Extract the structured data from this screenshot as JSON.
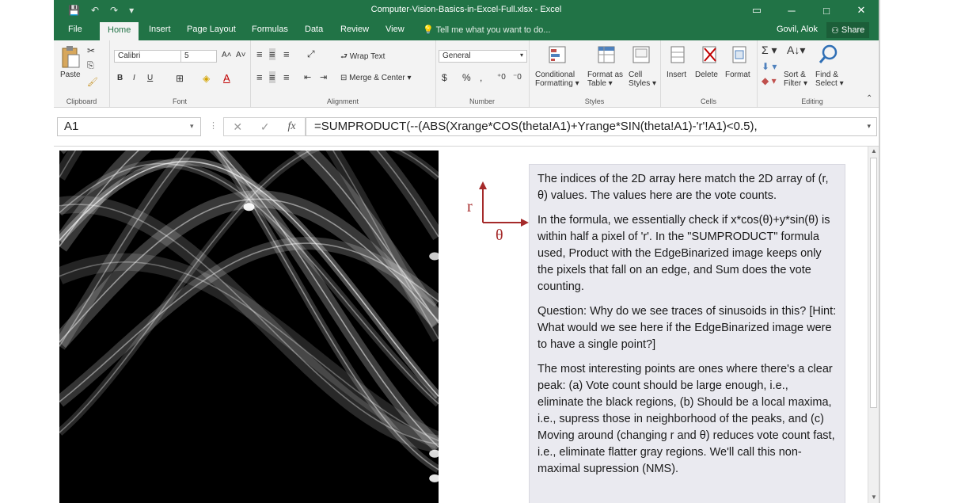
{
  "window": {
    "title": "Computer-Vision-Basics-in-Excel-Full.xlsx - Excel",
    "controls": [
      "▭",
      "─",
      "□",
      "✕"
    ]
  },
  "qat": {
    "save": "💾",
    "undo": "↶",
    "redo": "↷",
    "more": "▾"
  },
  "tabs": [
    "File",
    "Home",
    "Insert",
    "Page Layout",
    "Formulas",
    "Data",
    "Review",
    "View"
  ],
  "active_tab": "Home",
  "tellme": "Tell me what you want to do...",
  "user": "Govil, Alok",
  "share_label": "Share",
  "ribbon": {
    "clipboard": {
      "label": "Clipboard",
      "paste": "Paste"
    },
    "font": {
      "label": "Font",
      "name": "Calibri",
      "size": "5",
      "bold": "B",
      "italic": "I",
      "underline": "U"
    },
    "alignment": {
      "label": "Alignment",
      "wrap": "Wrap Text",
      "merge": "Merge & Center"
    },
    "number": {
      "label": "Number",
      "format": "General",
      "currency": "$",
      "percent": "%",
      "comma": ","
    },
    "styles": {
      "label": "Styles",
      "conditional_1": "Conditional",
      "conditional_2": "Formatting",
      "table_1": "Format as",
      "table_2": "Table",
      "cell_1": "Cell",
      "cell_2": "Styles"
    },
    "cells": {
      "label": "Cells",
      "insert": "Insert",
      "delete": "Delete",
      "format": "Format"
    },
    "editing": {
      "label": "Editing",
      "sort_1": "Sort &",
      "sort_2": "Filter",
      "find_1": "Find &",
      "find_2": "Select"
    }
  },
  "formula_bar": {
    "name_box": "A1",
    "fx": "fx",
    "formula": "=SUMPRODUCT(--(ABS(Xrange*COS(theta!A1)+Yrange*SIN(theta!A1)-'r'!A1)<0.5),"
  },
  "axes": {
    "r": "r",
    "theta": "θ"
  },
  "textbox": [
    "The indices of the 2D  array here match  the 2D array of (r, θ) values. The values here are the vote counts.",
    "In the formula, we essentially check if x*cos(θ)+y*sin(θ) is within half a pixel of 'r'.  In the \"SUMPRODUCT\" formula used, Product with the EdgeBinarized image keeps only the pixels that fall on an edge, and Sum does the vote counting.",
    "Question:  Why do we see traces of sinusoids in this? [Hint: What would we see here if the EdgeBinarized image were to have a single point?]",
    "The most interesting points are ones where there's a clear peak:  (a) Vote count should be large enough, i.e., eliminate the black regions, (b) Should be a local maxima, i.e., supress those in neighborhood of the peaks, and (c) Moving around (changing r and θ) reduces vote count fast, i.e., eliminate flatter gray regions.  We'll call this non-maximal supression (NMS)."
  ],
  "colors": {
    "excel_green": "#217346",
    "annotation_red": "#a52a2a"
  },
  "chart_data": {
    "type": "heatmap",
    "title": "",
    "xlabel": "θ",
    "ylabel": "r",
    "series": [
      {
        "amp": 0.52,
        "phase": 1.05,
        "offset": 0.52,
        "alpha": 0.3
      },
      {
        "amp": 0.62,
        "phase": 0.65,
        "offset": 0.58,
        "alpha": 0.24
      },
      {
        "amp": 0.44,
        "phase": 1.65,
        "offset": 0.48,
        "alpha": 0.22
      },
      {
        "amp": 0.7,
        "phase": 0.35,
        "offset": 0.66,
        "alpha": 0.2
      },
      {
        "amp": 0.36,
        "phase": 2.05,
        "offset": 0.42,
        "alpha": 0.2
      },
      {
        "amp": 0.58,
        "phase": 1.35,
        "offset": 0.62,
        "alpha": 0.22
      },
      {
        "amp": 0.48,
        "phase": 0.85,
        "offset": 0.55,
        "alpha": 0.18
      },
      {
        "amp": 0.66,
        "phase": 1.85,
        "offset": 0.6,
        "alpha": 0.18
      },
      {
        "amp": 0.4,
        "phase": 0.15,
        "offset": 0.5,
        "alpha": 0.16
      },
      {
        "amp": 0.55,
        "phase": 2.45,
        "offset": 0.56,
        "alpha": 0.16
      },
      {
        "amp": 0.74,
        "phase": 1.2,
        "offset": 0.7,
        "alpha": 0.14
      },
      {
        "amp": 0.32,
        "phase": 0.55,
        "offset": 0.4,
        "alpha": 0.14
      }
    ],
    "peaks": [
      {
        "x": 0.5,
        "y": 0.16,
        "intensity": 0.95
      },
      {
        "x": 0.99,
        "y": 0.3,
        "intensity": 0.8
      },
      {
        "x": 0.99,
        "y": 0.86,
        "intensity": 0.85
      },
      {
        "x": 0.99,
        "y": 0.93,
        "intensity": 0.9
      }
    ]
  }
}
